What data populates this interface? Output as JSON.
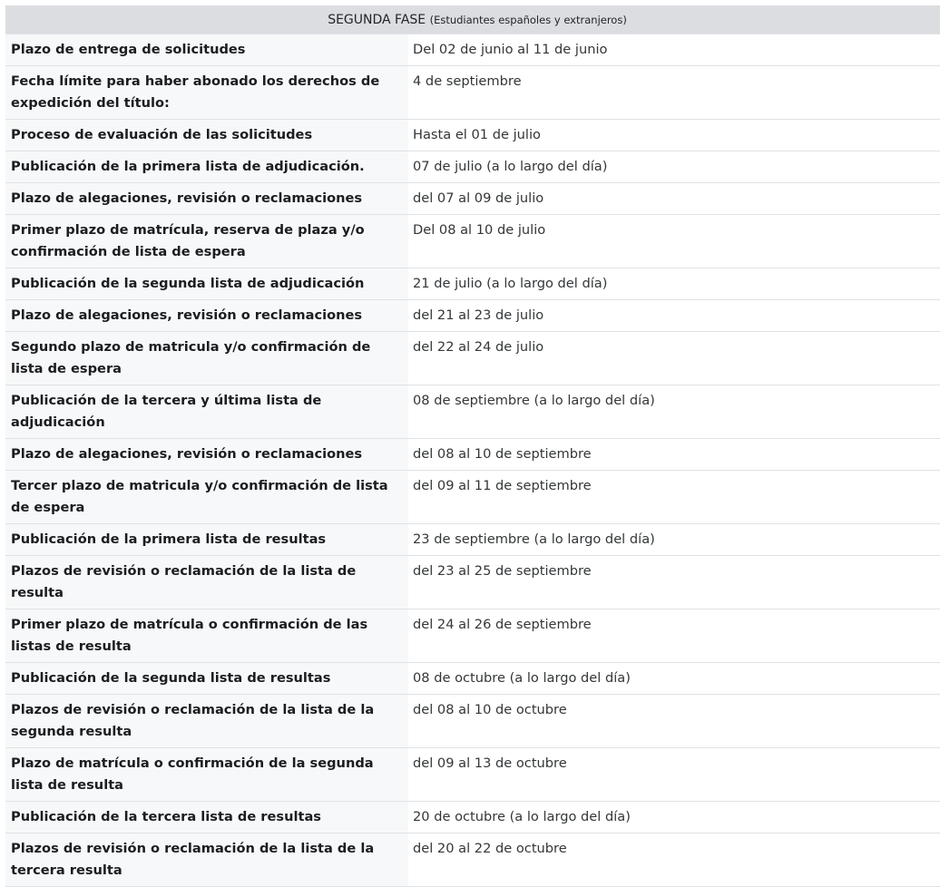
{
  "header": {
    "title": "SEGUNDA FASE",
    "subtitle": "(Estudiantes españoles y extranjeros)"
  },
  "rows": [
    {
      "label": "Plazo de entrega de solicitudes",
      "value": "Del 02 de junio al 11 de junio"
    },
    {
      "label": "Fecha límite para haber abonado los derechos de expedición del título:",
      "value": "4 de septiembre"
    },
    {
      "label": "Proceso de evaluación de las solicitudes",
      "value": "Hasta el 01 de julio"
    },
    {
      "label": "Publicación de la primera lista de adjudicación.",
      "value": "07 de julio (a lo largo del día)"
    },
    {
      "label": "Plazo de alegaciones, revisión o reclamaciones",
      "value": "del 07 al 09 de julio"
    },
    {
      "label": "Primer plazo de matrícula, reserva de plaza y/o confirmación de lista de espera",
      "value": "Del 08 al 10 de julio"
    },
    {
      "label": "Publicación de la segunda lista de adjudicación",
      "value": "21 de julio (a lo largo del día)"
    },
    {
      "label": "Plazo de alegaciones, revisión o reclamaciones",
      "value": "del 21 al 23 de julio"
    },
    {
      "label": "Segundo plazo de matricula y/o confirmación de lista de espera",
      "value": "del 22 al 24 de julio"
    },
    {
      "label": "Publicación de la tercera y última lista de adjudicación",
      "value": "08 de septiembre (a lo largo del día)"
    },
    {
      "label": "Plazo de alegaciones, revisión o reclamaciones",
      "value": "del 08 al 10 de septiembre"
    },
    {
      "label": "Tercer plazo de matricula y/o confirmación de lista de espera",
      "value": "del 09 al 11 de septiembre"
    },
    {
      "label": "Publicación de la primera lista de resultas",
      "value": "23 de septiembre (a lo largo del día)"
    },
    {
      "label": "Plazos de revisión o reclamación de la lista de resulta",
      "value": "del 23 al 25 de septiembre"
    },
    {
      "label": "Primer plazo de matrícula o confirmación de las listas de resulta",
      "value": "del 24 al 26 de septiembre"
    },
    {
      "label": "Publicación de la segunda lista de resultas",
      "value": "08 de octubre (a lo largo del día)"
    },
    {
      "label": "Plazos de revisión o reclamación de la lista de la segunda resulta",
      "value": "del 08 al 10 de octubre"
    },
    {
      "label": "Plazo de matrícula o confirmación de la segunda lista de resulta",
      "value": "del 09 al 13 de octubre"
    },
    {
      "label": "Publicación de la tercera lista de resultas",
      "value": "20 de octubre (a lo largo del día)"
    },
    {
      "label": "Plazos de revisión o reclamación de la lista de la tercera resulta",
      "value": "del 20 al 22 de octubre"
    }
  ]
}
